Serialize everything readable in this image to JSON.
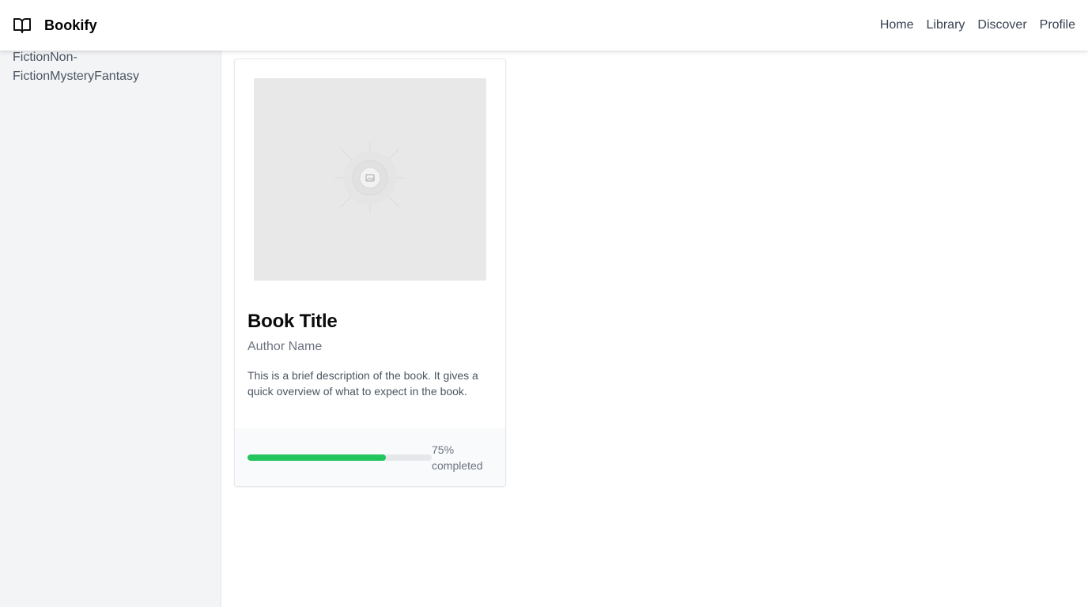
{
  "app": {
    "name": "Bookify",
    "icon": "open-book-icon"
  },
  "nav": {
    "links": [
      {
        "label": "Home"
      },
      {
        "label": "Library"
      },
      {
        "label": "Discover"
      },
      {
        "label": "Profile"
      }
    ]
  },
  "sidebar": {
    "genres": [
      "Fiction",
      "Non-Fiction",
      "Mystery",
      "Fantasy"
    ]
  },
  "book": {
    "cover_icon": "image-placeholder-icon",
    "title": "Book Title",
    "author": "Author Name",
    "description": "This is a brief description of the book. It gives a quick overview of what to expect in the book.",
    "progress": 0.75,
    "progress_label": "75% completed"
  },
  "colors": {
    "progress": "#22c55e",
    "sidebar_bg": "#f3f4f6",
    "cover_bg": "#e8e8e8"
  }
}
